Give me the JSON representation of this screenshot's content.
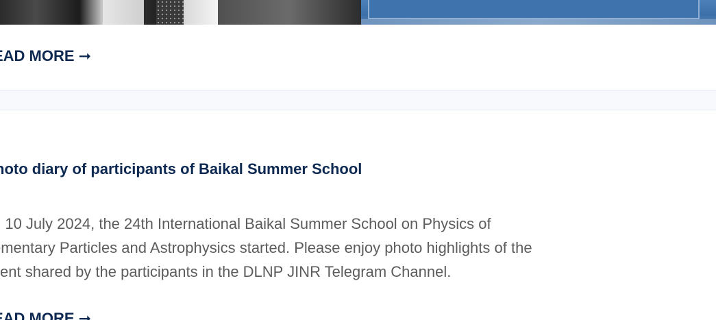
{
  "top_images": {
    "left_photo_alt": "",
    "right_photo_alt": ""
  },
  "news_item_1": {
    "read_more_label": "EAD MORE ➞"
  },
  "news_item_2": {
    "title": "hoto diary of participants of Baikal Summer School",
    "body_lines": [
      "n 10 July 2024, the 24th International Baikal Summer School on Physics of",
      "ementary Particles and Astrophysics started. Please enjoy photo highlights of the",
      "vent shared by the participants in the DLNP JINR Telegram Channel."
    ],
    "read_more_label": "EAD MORE ➞"
  },
  "colors": {
    "title": "#0e2a52",
    "body_text": "#5c5c5c",
    "divider_bg": "#f7f9fc"
  }
}
